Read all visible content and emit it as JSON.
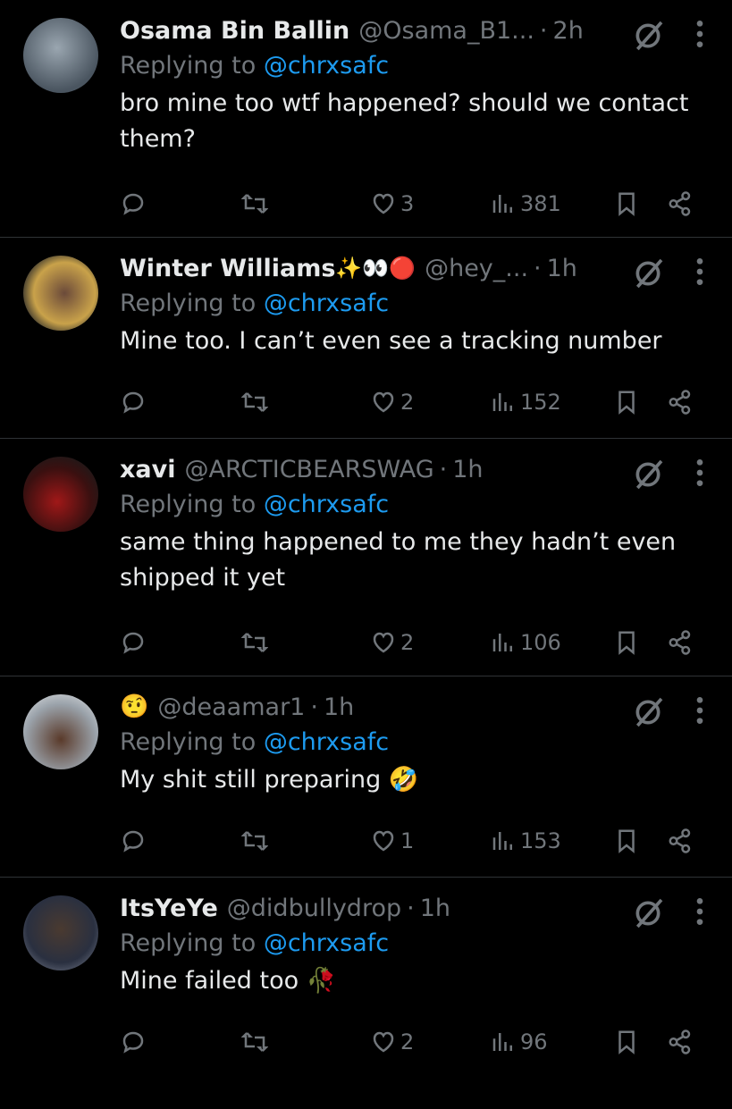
{
  "tweets": [
    {
      "name": "Osama Bin Ballin",
      "handle": "@Osama_B1...",
      "time": "2h",
      "replying_prefix": "Replying to ",
      "replying_to": "@chrxsafc",
      "text": "bro mine too wtf happened? should we contact them?",
      "likes": "3",
      "views": "381",
      "avatar_color": "#6b7a88"
    },
    {
      "name": "Winter Williams",
      "name_emoji": "✨👀🔴",
      "handle": "@hey_...",
      "time": "1h",
      "replying_prefix": "Replying to ",
      "replying_to": "@chrxsafc",
      "text": "Mine too. I can’t even see a tracking number",
      "likes": "2",
      "views": "152",
      "avatar_color": "#5a4a40"
    },
    {
      "name": "xavi",
      "handle": "@ARCTICBEARSWAG",
      "time": "1h",
      "replying_prefix": "Replying to ",
      "replying_to": "@chrxsafc",
      "text": "same thing happened to me they hadn’t even shipped it yet",
      "likes": "2",
      "views": "106",
      "avatar_color": "#7a1f1f"
    },
    {
      "name_emoji": "🤨",
      "handle": "@deaamar1",
      "time": "1h",
      "replying_prefix": "Replying to ",
      "replying_to": "@chrxsafc",
      "text": "My shit still preparing",
      "text_emoji": "🤣",
      "likes": "1",
      "views": "153",
      "avatar_color": "#8a8f96"
    },
    {
      "name": "ItsYeYe",
      "handle": "@didbullydrop",
      "time": "1h",
      "replying_prefix": "Replying to ",
      "replying_to": "@chrxsafc",
      "text": "Mine failed too",
      "text_emoji": "🥀",
      "likes": "2",
      "views": "96",
      "avatar_color": "#3c4450"
    }
  ],
  "colors": {
    "background": "#000000",
    "text": "#e7e9ea",
    "muted": "#71767b",
    "link": "#1d9bf0",
    "divider": "#2f3336"
  },
  "icons": [
    "reply-icon",
    "retweet-icon",
    "like-icon",
    "views-icon",
    "bookmark-icon",
    "share-icon",
    "grok-icon",
    "more-icon"
  ]
}
